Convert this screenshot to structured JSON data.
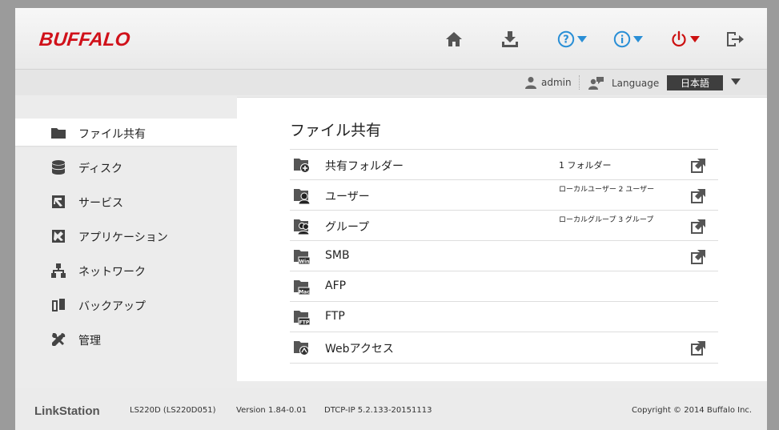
{
  "header": {
    "logo": "BUFFALO",
    "icons": [
      "home-icon",
      "download-icon",
      "help-icon",
      "info-icon",
      "power-icon",
      "logout-icon"
    ],
    "accent": "#2a8fd6",
    "power_color": "#cc1111"
  },
  "subbar": {
    "user": "admin",
    "language_label": "Language",
    "language_value": "日本語"
  },
  "sidebar": {
    "items": [
      {
        "label": "ファイル共有",
        "icon": "folder-icon",
        "active": true
      },
      {
        "label": "ディスク",
        "icon": "disk-icon"
      },
      {
        "label": "サービス",
        "icon": "service-icon"
      },
      {
        "label": "アプリケーション",
        "icon": "application-icon"
      },
      {
        "label": "ネットワーク",
        "icon": "network-icon"
      },
      {
        "label": "バックアップ",
        "icon": "backup-icon"
      },
      {
        "label": "管理",
        "icon": "tools-icon"
      }
    ]
  },
  "main": {
    "title": "ファイル共有",
    "rows": [
      {
        "label": "共有フォルダー",
        "info": "1 フォルダー",
        "link": true
      },
      {
        "label": "ユーザー",
        "info": "ローカルユーザー 2 ユーザー",
        "link": true
      },
      {
        "label": "グループ",
        "info": "ローカルグループ 3 グループ",
        "link": true
      },
      {
        "label": "SMB",
        "info": "",
        "link": true
      },
      {
        "label": "AFP",
        "info": "",
        "link": false
      },
      {
        "label": "FTP",
        "info": "",
        "link": false
      },
      {
        "label": "Webアクセス",
        "info": "",
        "link": true
      }
    ]
  },
  "footer": {
    "brand": "LinkStation",
    "model": "LS220D (LS220D051)",
    "version": "Version 1.84-0.01",
    "dtcp": "DTCP-IP 5.2.133-20151113",
    "copyright": "Copyright © 2014 Buffalo Inc."
  }
}
